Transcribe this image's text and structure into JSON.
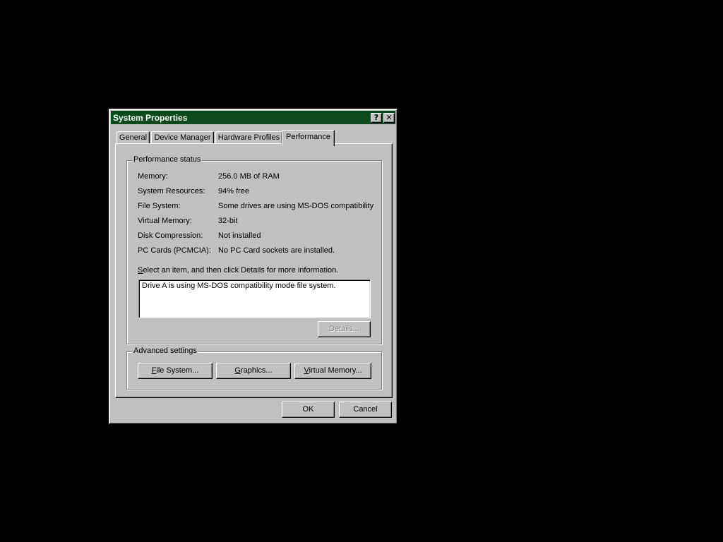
{
  "window": {
    "title": "System Properties",
    "help_button": "?",
    "close_button": "✕"
  },
  "tabs": [
    {
      "label": "General",
      "active": false
    },
    {
      "label": "Device Manager",
      "active": false
    },
    {
      "label": "Hardware Profiles",
      "active": false
    },
    {
      "label": "Performance",
      "active": true
    }
  ],
  "performance_status": {
    "group_title": "Performance status",
    "rows": [
      {
        "label": "Memory:",
        "value": "256.0 MB of RAM"
      },
      {
        "label": "System Resources:",
        "value": "94% free"
      },
      {
        "label": "File System:",
        "value": "Some drives are using MS-DOS compatibility"
      },
      {
        "label": "Virtual Memory:",
        "value": "32-bit"
      },
      {
        "label": "Disk Compression:",
        "value": "Not installed"
      },
      {
        "label": "PC Cards (PCMCIA):",
        "value": "No PC Card sockets are installed."
      }
    ],
    "instruction_first": "S",
    "instruction_rest": "elect an item, and then click Details for more information.",
    "list_item": "Drive A is using MS-DOS compatibility mode file system.",
    "details_button": "Details..."
  },
  "advanced_settings": {
    "group_title": "Advanced settings",
    "file_system_button_first": "F",
    "file_system_button_rest": "ile System...",
    "graphics_button_first": "G",
    "graphics_button_rest": "raphics...",
    "virtual_memory_button_first": "V",
    "virtual_memory_button_rest": "irtual Memory..."
  },
  "footer": {
    "ok_button": "OK",
    "cancel_button": "Cancel"
  },
  "colors": {
    "desktop": "#000000",
    "title_bar": "#0b4a1b",
    "face": "#c0c0c0"
  }
}
